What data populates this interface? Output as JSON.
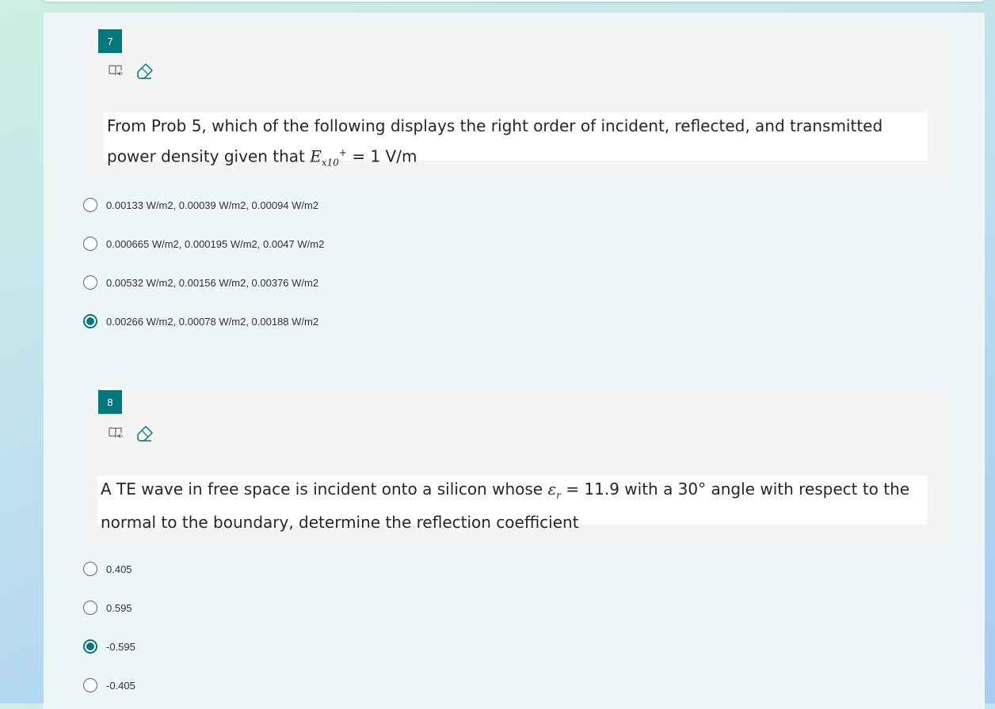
{
  "questions": [
    {
      "number": "7",
      "text_line1": "From Prob 5, which of the following displays the right order of incident, reflected, and transmitted",
      "text_line2_prefix": "power density given that ",
      "text_line2_var": "E",
      "text_line2_sub": "x10",
      "text_line2_sup": "+",
      "text_line2_suffix": " = 1 V/m",
      "options": [
        {
          "label": "0.00133 W/m2, 0.00039 W/m2, 0.00094 W/m2",
          "selected": false
        },
        {
          "label": "0.000665 W/m2, 0.000195 W/m2, 0.0047 W/m2",
          "selected": false
        },
        {
          "label": "0.00532 W/m2, 0.00156 W/m2, 0.00376 W/m2",
          "selected": false
        },
        {
          "label": "0.00266 W/m2, 0.00078 W/m2, 0.00188 W/m2",
          "selected": true
        }
      ]
    },
    {
      "number": "8",
      "text_line1_prefix": "A TE wave in free space is incident onto a silicon whose ",
      "text_line1_var": "ε",
      "text_line1_sub": "r",
      "text_line1_suffix": " = 11.9 with a 30° angle with respect to the",
      "text_line2": "normal to the boundary, determine the reflection coefficient",
      "options": [
        {
          "label": "0.405",
          "selected": false
        },
        {
          "label": "0.595",
          "selected": false
        },
        {
          "label": "-0.595",
          "selected": true
        },
        {
          "label": "-0.405",
          "selected": false
        }
      ]
    }
  ],
  "icons": {
    "immersive_reader": "immersive-reader-icon",
    "eraser": "eraser-icon"
  },
  "colors": {
    "accent": "#03787c",
    "panel": "#eff6f8",
    "question_box": "#f4f4f4"
  }
}
